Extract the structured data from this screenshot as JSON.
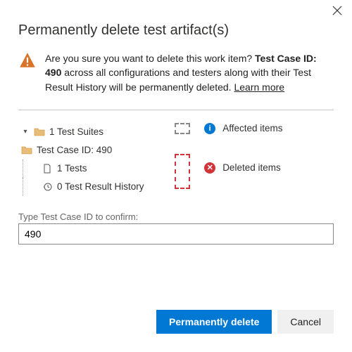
{
  "title": "Permanently delete test artifact(s)",
  "warning": {
    "prefix": "Are you sure you want to delete this work item? ",
    "bold": "Test Case ID: 490",
    "suffix": " across all configurations and testers along with their Test Result History will be permanently deleted. ",
    "learn_more": "Learn more"
  },
  "tree": {
    "suites": "1 Test Suites",
    "case": "Test Case ID: 490",
    "tests": "1 Tests",
    "history": "0 Test Result History"
  },
  "legend": {
    "affected": "Affected items",
    "deleted": "Deleted items"
  },
  "confirm": {
    "label": "Type Test Case ID to confirm:",
    "value": "490"
  },
  "buttons": {
    "primary": "Permanently delete",
    "secondary": "Cancel"
  }
}
